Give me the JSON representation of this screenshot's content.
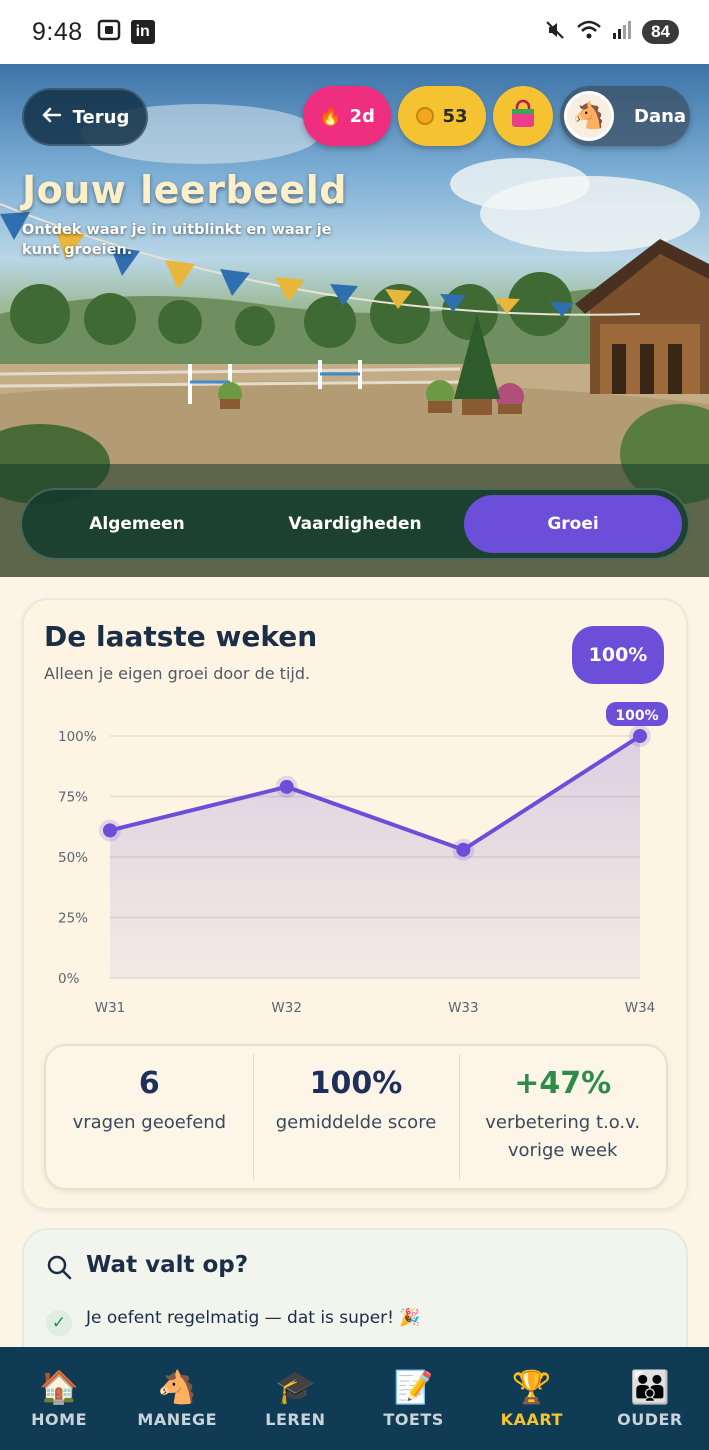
{
  "status_bar": {
    "time": "9:48",
    "battery": "84",
    "icons": [
      "screenshot-icon",
      "linkedin-icon",
      "mute-icon",
      "wifi-icon",
      "signal-icon"
    ]
  },
  "header": {
    "back_label": "Terug",
    "streak": "2d",
    "coins": "53",
    "user_name": "Dana",
    "title": "Jouw leerbeeld",
    "subtitle": "Ontdek waar je in uitblinkt en waar je kunt groeien."
  },
  "tabs": [
    {
      "label": "Algemeen",
      "active": false
    },
    {
      "label": "Vaardigheden",
      "active": false
    },
    {
      "label": "Groei",
      "active": true
    }
  ],
  "progress_card": {
    "title": "De laatste weken",
    "subtitle": "Alleen je eigen groei door de tijd.",
    "badge": "100%"
  },
  "chart_data": {
    "type": "area",
    "categories": [
      "W31",
      "W32",
      "W33",
      "W34"
    ],
    "series": [
      {
        "values": [
          61,
          79,
          53,
          100
        ]
      }
    ],
    "ylim": [
      0,
      100
    ],
    "yticks": [
      "0%",
      "25%",
      "50%",
      "75%",
      "100%"
    ],
    "point_label": "100%",
    "grid": true,
    "color": "#6b4fd8"
  },
  "stats": [
    {
      "value": "6",
      "label": "vragen geoefend",
      "color": "#1e2f5a"
    },
    {
      "value": "100%",
      "label": "gemiddelde score",
      "color": "#1e2f5a"
    },
    {
      "value": "+47%",
      "label": "verbetering t.o.v. vorige week",
      "color": "#2e8c4a"
    }
  ],
  "insights_card": {
    "title": "Wat valt op?",
    "items": [
      "Je oefent regelmatig — dat is super! 🎉"
    ]
  },
  "bottom_nav": [
    {
      "label": "HOME",
      "icon": "🏠",
      "active": false
    },
    {
      "label": "MANEGE",
      "icon": "🐴",
      "active": false
    },
    {
      "label": "LEREN",
      "icon": "🎓",
      "active": false
    },
    {
      "label": "TOETS",
      "icon": "📝",
      "active": false
    },
    {
      "label": "KAART",
      "icon": "🏆",
      "active": true
    },
    {
      "label": "OUDER",
      "icon": "👪",
      "active": false
    }
  ]
}
